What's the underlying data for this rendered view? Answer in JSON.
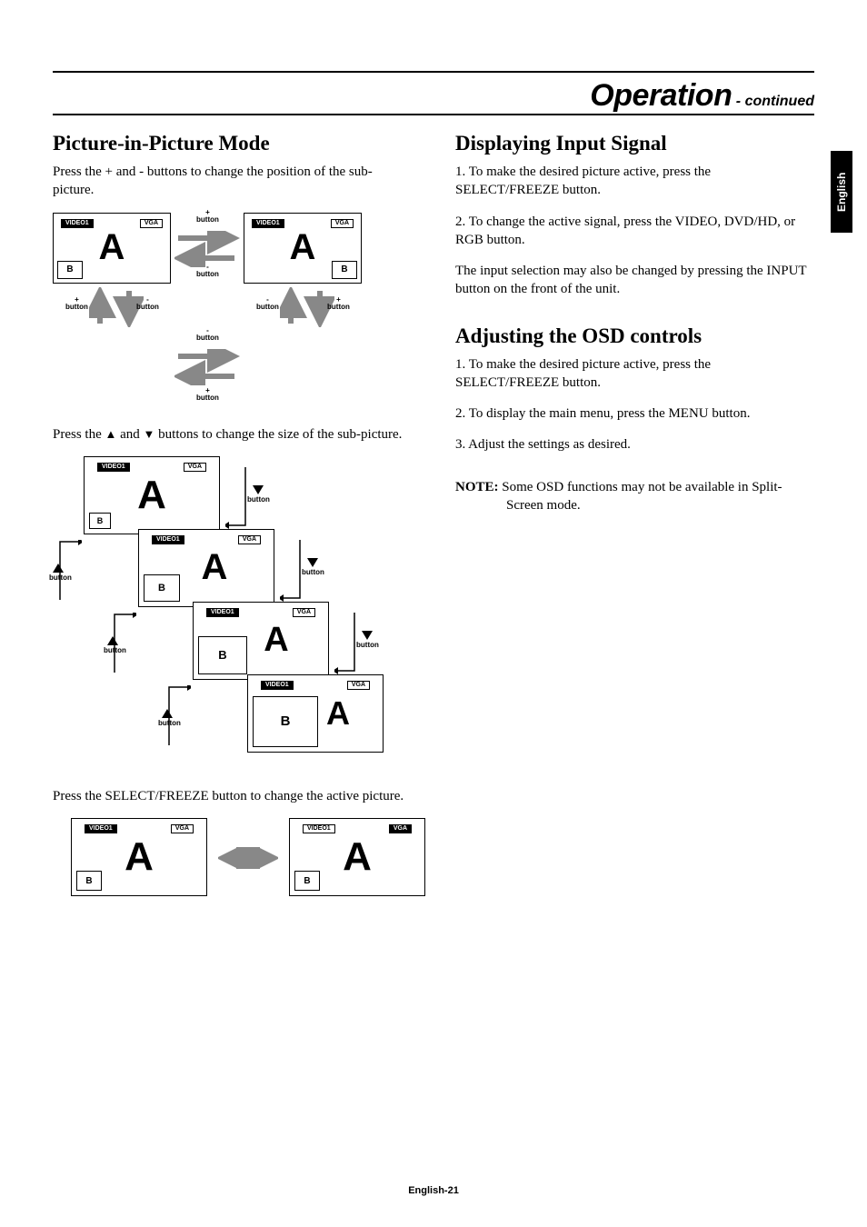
{
  "header": {
    "title": "Operation",
    "continued": " - continued"
  },
  "side_tab": "English",
  "left": {
    "h_pip": "Picture-in-Picture Mode",
    "p_plusminus": "Press the + and - buttons to change the position of the sub-picture.",
    "p_updown_pre": "Press the ",
    "p_updown_mid": " and ",
    "p_updown_post": " buttons to change the size of the sub-picture.",
    "p_selectfreeze": "Press the SELECT/FREEZE button to change the active picture.",
    "labels": {
      "plus_button": "+\nbutton",
      "minus_button": "-\nbutton",
      "button": "button",
      "A": "A",
      "B": "B",
      "video1": "VIDEO1",
      "vga": "VGA"
    }
  },
  "right": {
    "h_display": "Displaying Input Signal",
    "p_d1": "1. To make the desired picture active, press the SELECT/FREEZE button.",
    "p_d2": "2. To change the active signal, press the VIDEO, DVD/HD, or RGB button.",
    "p_d3": "The input selection may also be changed by pressing the INPUT button on the front of the unit.",
    "h_osd": "Adjusting the OSD controls",
    "p_o1": "1. To make the desired picture active, press the SELECT/FREEZE button.",
    "p_o2": "2. To display the main menu, press the MENU button.",
    "p_o3": "3. Adjust the settings as desired.",
    "note_label": "NOTE: ",
    "note_text": "Some OSD functions may not be available in Split-Screen mode."
  },
  "footer": "English-21"
}
